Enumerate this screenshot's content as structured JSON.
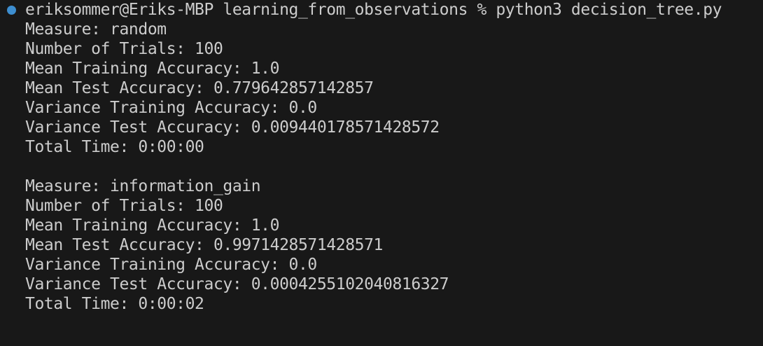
{
  "terminal": {
    "status_color": "#3d8ed0",
    "prompt": "eriksommer@Eriks-MBP learning_from_observations % python3 decision_tree.py",
    "lines": [
      "Measure: random",
      "Number of Trials: 100",
      "Mean Training Accuracy: 1.0",
      "Mean Test Accuracy: 0.779642857142857",
      "Variance Training Accuracy: 0.0",
      "Variance Test Accuracy: 0.009440178571428572",
      "Total Time: 0:00:00",
      "",
      "Measure: information_gain",
      "Number of Trials: 100",
      "Mean Training Accuracy: 1.0",
      "Mean Test Accuracy: 0.9971428571428571",
      "Variance Training Accuracy: 0.0",
      "Variance Test Accuracy: 0.0004255102040816327",
      "Total Time: 0:00:02"
    ]
  }
}
